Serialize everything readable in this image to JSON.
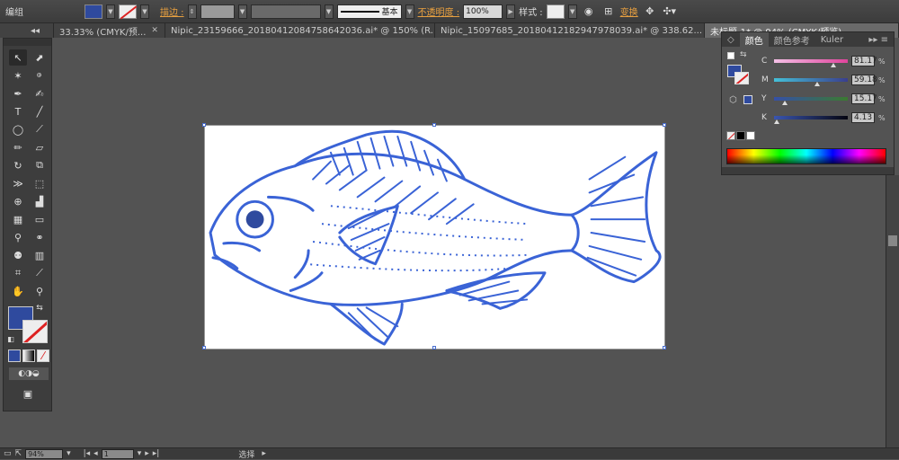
{
  "control_bar": {
    "mode_label": "编组",
    "stroke_label": "描边 :",
    "stroke_style_label": "基本",
    "opacity_label": "不透明度 :",
    "opacity_value": "100%",
    "style_label": "样式 :",
    "transform_label": "变换"
  },
  "tabs": [
    {
      "label": "33.33% (CMYK/预..."
    },
    {
      "label": "Nipic_23159666_20180412084758642036.ai* @ 150% (R..."
    },
    {
      "label": "Nipic_15097685_20180412182947978039.ai* @ 338.62..."
    },
    {
      "label": "未标题-1* @ 94% (CMYK/预览)"
    }
  ],
  "color_panel": {
    "tabs": [
      "颜色",
      "颜色参考",
      "Kuler"
    ],
    "channels": [
      {
        "name": "C",
        "value": "81.17",
        "level": 0.81
      },
      {
        "name": "M",
        "value": "59.18",
        "level": 0.59
      },
      {
        "name": "Y",
        "value": "15.17",
        "level": 0.15
      },
      {
        "name": "K",
        "value": "4.13",
        "level": 0.04
      }
    ],
    "unit": "%"
  },
  "status": {
    "zoom": "94%",
    "page": "1",
    "tool_label": "选择"
  },
  "colors": {
    "fill": "#2f4a9e",
    "stroke_art": "#3a63d6",
    "accent": "#e8a040"
  },
  "icons": [
    "selection-icon",
    "direct-selection-icon",
    "magic-wand-icon",
    "lasso-icon",
    "pen-icon",
    "curvature-icon",
    "type-icon",
    "line-icon",
    "ellipse-icon",
    "paintbrush-icon",
    "pencil-icon",
    "eraser-icon",
    "rotate-icon",
    "scale-icon",
    "width-icon",
    "free-transform-icon",
    "shape-builder-icon",
    "graph-icon",
    "mesh-icon",
    "gradient-icon",
    "eyedropper-icon",
    "blend-icon",
    "symbol-sprayer-icon",
    "column-graph-icon",
    "artboard-icon",
    "slice-icon",
    "hand-icon",
    "zoom-icon"
  ]
}
